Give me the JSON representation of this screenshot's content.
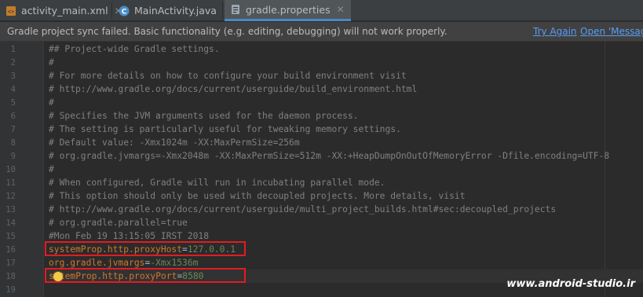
{
  "tabs": [
    {
      "label": "activity_main.xml",
      "icon": "xml-file-icon",
      "active": false
    },
    {
      "label": "MainActivity.java",
      "icon": "java-class-icon",
      "active": false
    },
    {
      "label": "gradle.properties",
      "icon": "properties-file-icon",
      "active": true
    }
  ],
  "notification": {
    "message": "Gradle project sync failed. Basic functionality (e.g. editing, debugging) will not work properly.",
    "try_again": "Try Again",
    "open_messages": "Open 'Message"
  },
  "editor": {
    "line_numbers": [
      "1",
      "2",
      "3",
      "4",
      "5",
      "6",
      "7",
      "8",
      "9",
      "10",
      "11",
      "12",
      "13",
      "14",
      "15",
      "16",
      "17",
      "18",
      "19"
    ],
    "comments": [
      "## Project-wide Gradle settings.",
      "#",
      "# For more details on how to configure your build environment visit",
      "# http://www.gradle.org/docs/current/userguide/build_environment.html",
      "#",
      "# Specifies the JVM arguments used for the daemon process.",
      "# The setting is particularly useful for tweaking memory settings.",
      "# Default value: -Xmx1024m -XX:MaxPermSize=256m",
      "# org.gradle.jvmargs=-Xmx2048m -XX:MaxPermSize=512m -XX:+HeapDumpOnOutOfMemoryError -Dfile.encoding=UTF-8",
      "#",
      "# When configured, Gradle will run in incubating parallel mode.",
      "# This option should only be used with decoupled projects. More details, visit",
      "# http://www.gradle.org/docs/current/userguide/multi_project_builds.html#sec:decoupled_projects",
      "# org.gradle.parallel=true",
      "#Mon Feb 19 13:15:05 IRST 2018"
    ],
    "props": [
      {
        "key": "systemProp.http.proxyHost",
        "eq": "=",
        "value": "127.0.0.1",
        "highlighted": true
      },
      {
        "key": "org.gradle.jvmargs",
        "eq": "=",
        "value": "-Xmx1536m",
        "highlighted": false
      },
      {
        "key_prefix": "s",
        "key_rest": "temProp.http.proxyPort",
        "eq": "=",
        "value": "8580",
        "highlighted": true
      }
    ]
  },
  "watermark": "www.android-studio.ir",
  "colors": {
    "accent": "#4a88c7",
    "link": "#589df6",
    "highlight_box": "#e31b23",
    "property_key": "#cc7832",
    "property_value": "#6a8759",
    "comment": "#808080"
  }
}
